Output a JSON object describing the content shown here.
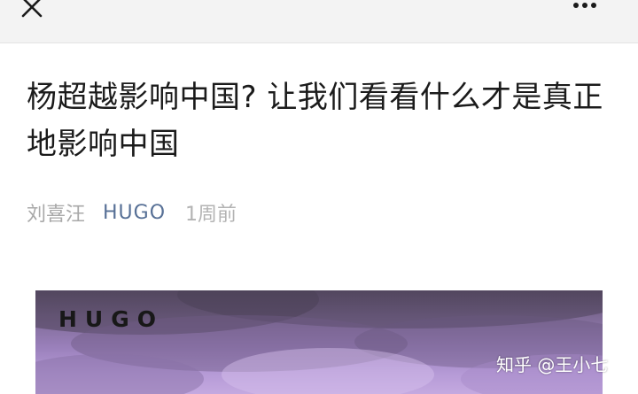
{
  "topbar": {
    "close_icon": "close-icon",
    "more_icon": "more-horizontal-icon"
  },
  "article": {
    "title": "杨超越影响中国? 让我们看看什么才是真正地影响中国",
    "author": "刘喜汪",
    "account": "HUGO",
    "time": "1周前"
  },
  "cover": {
    "logo_text": "HUGO",
    "watermark": "知乎 @王小七"
  },
  "colors": {
    "topbar_bg": "#f3f3f3",
    "title": "#1b1b1b",
    "meta_gray": "#a8a8a8",
    "account_blue": "#577096",
    "cover_purple": "#9a80bb"
  }
}
